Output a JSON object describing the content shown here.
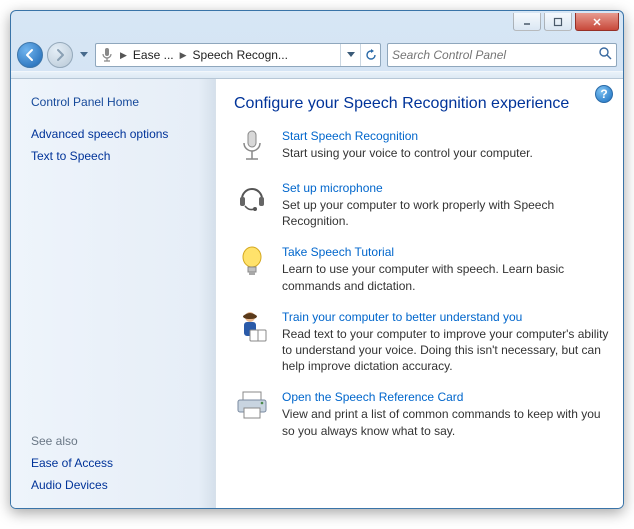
{
  "window": {
    "min_tip": "Minimize",
    "max_tip": "Maximize",
    "close_tip": "Close"
  },
  "breadcrumb": {
    "item1": "Ease ...",
    "item2": "Speech Recogn..."
  },
  "search": {
    "placeholder": "Search Control Panel"
  },
  "sidebar": {
    "home": "Control Panel Home",
    "items": [
      {
        "label": "Advanced speech options"
      },
      {
        "label": "Text to Speech"
      }
    ],
    "see_also_label": "See also",
    "see_also": [
      {
        "label": "Ease of Access"
      },
      {
        "label": "Audio Devices"
      }
    ]
  },
  "content": {
    "title": "Configure your Speech Recognition experience",
    "tasks": [
      {
        "link": "Start Speech Recognition",
        "desc": "Start using your voice to control your computer."
      },
      {
        "link": "Set up microphone",
        "desc": "Set up your computer to work properly with Speech Recognition."
      },
      {
        "link": "Take Speech Tutorial",
        "desc": "Learn to use your computer with speech.  Learn basic commands and dictation."
      },
      {
        "link": "Train your computer to better understand you",
        "desc": "Read text to your computer to improve your computer's ability to understand your voice.  Doing this isn't necessary, but can help improve dictation accuracy."
      },
      {
        "link": "Open the Speech Reference Card",
        "desc": "View and print a list of common commands to keep with you so you always know what to say."
      }
    ]
  }
}
